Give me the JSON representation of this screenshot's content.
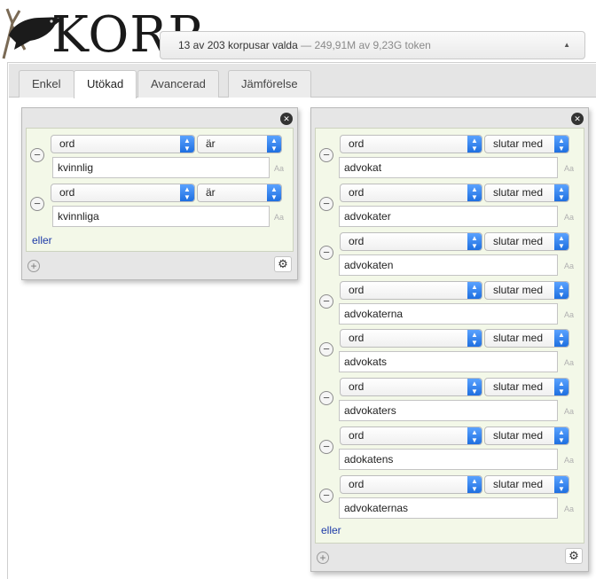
{
  "header": {
    "logo_text": "KORP",
    "corpus": {
      "selected": "13 av 203 korpusar valda",
      "separator": " — ",
      "tokens": "249,91M av 9,23G token"
    }
  },
  "tabs": [
    {
      "label": "Enkel",
      "active": false
    },
    {
      "label": "Utökad",
      "active": true
    },
    {
      "label": "Avancerad",
      "active": false
    },
    {
      "label": "Jämförelse",
      "active": false
    }
  ],
  "tokens": [
    {
      "rows": [
        {
          "attribute": "ord",
          "operator": "är",
          "value": "kvinnlig",
          "case": "Aa"
        },
        {
          "attribute": "ord",
          "operator": "är",
          "value": "kvinnliga",
          "case": "Aa"
        }
      ],
      "or_label": "eller"
    },
    {
      "rows": [
        {
          "attribute": "ord",
          "operator": "slutar med",
          "value": "advokat",
          "case": "Aa"
        },
        {
          "attribute": "ord",
          "operator": "slutar med",
          "value": "advokater",
          "case": "Aa"
        },
        {
          "attribute": "ord",
          "operator": "slutar med",
          "value": "advokaten",
          "case": "Aa"
        },
        {
          "attribute": "ord",
          "operator": "slutar med",
          "value": "advokaterna",
          "case": "Aa"
        },
        {
          "attribute": "ord",
          "operator": "slutar med",
          "value": "advokats",
          "case": "Aa"
        },
        {
          "attribute": "ord",
          "operator": "slutar med",
          "value": "advokaters",
          "case": "Aa"
        },
        {
          "attribute": "ord",
          "operator": "slutar med",
          "value": "adokatens",
          "case": "Aa"
        },
        {
          "attribute": "ord",
          "operator": "slutar med",
          "value": "advokaternas",
          "case": "Aa"
        }
      ],
      "or_label": "eller"
    }
  ],
  "icons": {
    "close": "close-icon",
    "remove": "minus-circle-icon",
    "add": "plus-circle-icon",
    "settings": "gear-icon",
    "dropdown": "chevron-updown-icon",
    "logo_bird": "raven-icon"
  },
  "colors": {
    "accent": "#1e6fe0",
    "token_bg": "#f3f8e8",
    "link": "#1d3aa7"
  }
}
